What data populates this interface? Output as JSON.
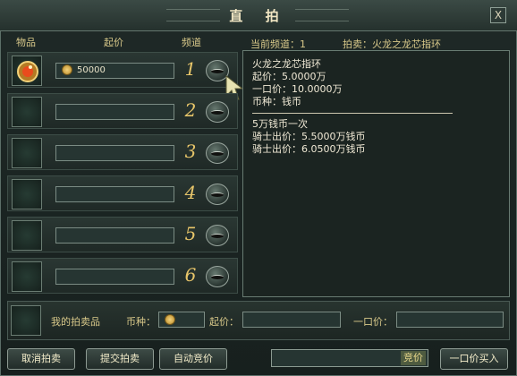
{
  "dialog": {
    "title": "直 拍",
    "close_label": "X"
  },
  "columns": {
    "item": "物品",
    "price": "起价",
    "channel": "频道"
  },
  "slots": [
    {
      "channel": "1",
      "price": "50000",
      "has_item": true
    },
    {
      "channel": "2",
      "price": "",
      "has_item": false
    },
    {
      "channel": "3",
      "price": "",
      "has_item": false
    },
    {
      "channel": "4",
      "price": "",
      "has_item": false
    },
    {
      "channel": "5",
      "price": "",
      "has_item": false
    },
    {
      "channel": "6",
      "price": "",
      "has_item": false
    }
  ],
  "right": {
    "current_channel_label": "当前频道：1",
    "auction_label": "拍卖：火龙之龙芯指环",
    "details": [
      "火龙之龙芯指环",
      "起价：5.0000万",
      "一口价：10.0000万",
      "币种：钱币"
    ],
    "history": [
      "5万钱币一次",
      "骑士出价：5.5000万钱币",
      "骑士出价：6.0500万钱币"
    ]
  },
  "my_item": {
    "label": "我的拍卖品",
    "currency_label": "币种：",
    "start_price_label": "起价：",
    "buyout_label": "一口价："
  },
  "bottom_buttons": {
    "cancel": "取消拍卖",
    "submit": "提交拍卖",
    "auto_bid": "自动竞价",
    "bid": "竞价",
    "buyout": "一口价买入"
  },
  "colors": {
    "gold_text": "#d9c98a",
    "channel_number": "#e8c66a",
    "panel_bg": "#1b2421",
    "border": "#687b72"
  }
}
